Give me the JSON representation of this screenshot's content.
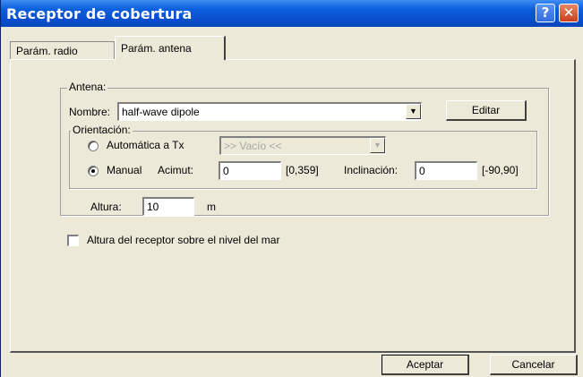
{
  "window": {
    "title": "Receptor de cobertura",
    "help_label": "?",
    "close_label": "✕"
  },
  "tabs": [
    {
      "label": "Parám. radio",
      "active": false
    },
    {
      "label": "Parám. antena",
      "active": true
    }
  ],
  "antena": {
    "group_label": "Antena:",
    "nombre_label": "Nombre:",
    "nombre_value": "half-wave dipole",
    "editar_label": "Editar",
    "orientacion": {
      "group_label": "Orientación:",
      "auto_label": "Automática a Tx",
      "auto_selected": false,
      "auto_combo_value": ">> Vacío <<",
      "manual_label": "Manual",
      "manual_selected": true,
      "acimut_label": "Acimut:",
      "acimut_value": "0",
      "acimut_range": "[0,359]",
      "inclinacion_label": "Inclinación:",
      "inclinacion_value": "0",
      "inclinacion_range": "[-90,90]"
    },
    "altura_label": "Altura:",
    "altura_value": "10",
    "altura_unit": "m"
  },
  "nivel_mar": {
    "label": "Altura del receptor sobre el nivel del mar",
    "checked": false
  },
  "footer": {
    "aceptar_label": "Aceptar",
    "cancelar_label": "Cancelar"
  },
  "colors": {
    "titlebar": "#0a4fd0",
    "dialog_bg": "#ece9d8"
  }
}
